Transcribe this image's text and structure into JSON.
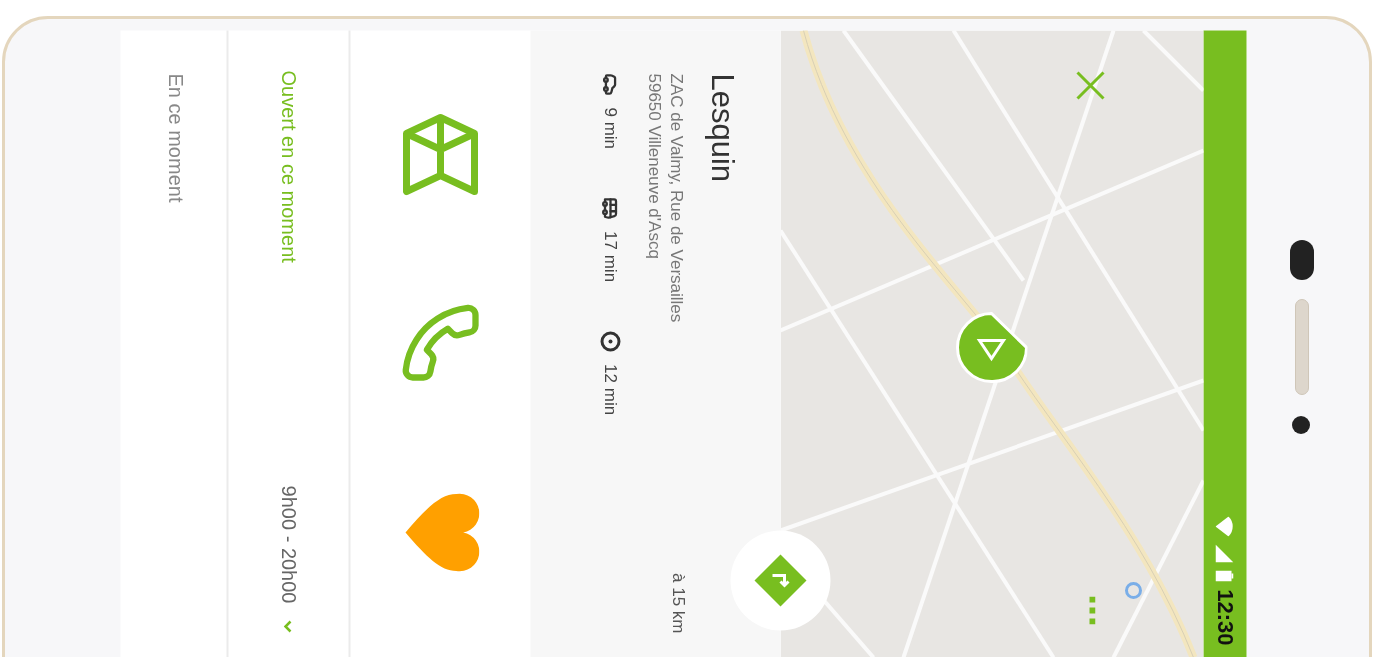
{
  "status_bar": {
    "time": "12:30"
  },
  "place": {
    "name": "Lesquin",
    "address_lines": [
      "ZAC de Valmy, Rue de Versailles",
      "59650 Villeneuve d'Ascq"
    ],
    "distance": "à 15 km",
    "travel_times": [
      {
        "kind": "car",
        "duration": "9 min"
      },
      {
        "kind": "bus",
        "duration": "17 min"
      },
      {
        "kind": "walk",
        "duration": "12 min"
      }
    ]
  },
  "actions": [
    {
      "kind": "map"
    },
    {
      "kind": "phone"
    },
    {
      "kind": "favorite",
      "selected": true
    }
  ],
  "hours": {
    "status": "Ouvert en ce moment",
    "open": true,
    "range": "9h00 - 20h00",
    "expanded": false
  },
  "news": {
    "title": "En ce moment"
  }
}
